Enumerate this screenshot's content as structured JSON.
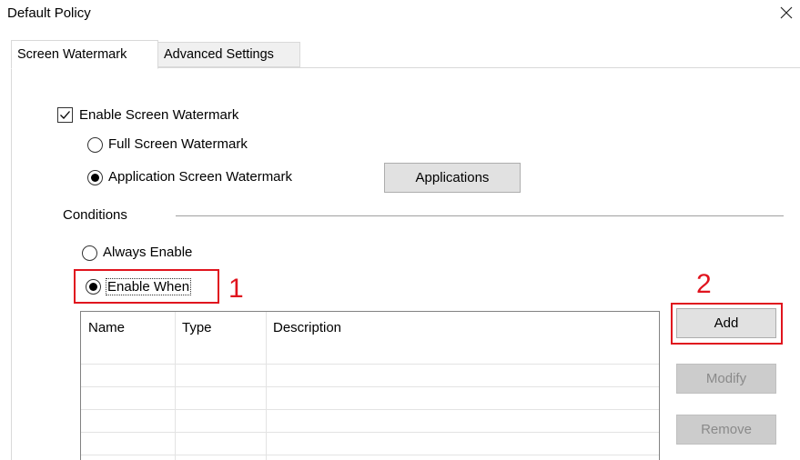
{
  "window": {
    "title": "Default Policy"
  },
  "tabs": [
    {
      "label": "Screen Watermark",
      "active": true
    },
    {
      "label": "Advanced Settings",
      "active": false
    }
  ],
  "watermark": {
    "enable_label": "Enable Screen Watermark",
    "enable_checked": true,
    "full_screen_label": "Full Screen Watermark",
    "full_screen_selected": false,
    "app_screen_label": "Application Screen Watermark",
    "app_screen_selected": true,
    "applications_button": "Applications"
  },
  "conditions": {
    "group_label": "Conditions",
    "always_enable_label": "Always Enable",
    "always_enable_selected": false,
    "enable_when_label": "Enable When",
    "enable_when_selected": true,
    "table": {
      "columns": [
        "Name",
        "Type",
        "Description"
      ],
      "rows": []
    },
    "buttons": {
      "add": "Add",
      "modify": "Modify",
      "remove": "Remove"
    }
  },
  "annotations": {
    "marker_1": "1",
    "marker_2": "2",
    "color": "#e0141e"
  }
}
